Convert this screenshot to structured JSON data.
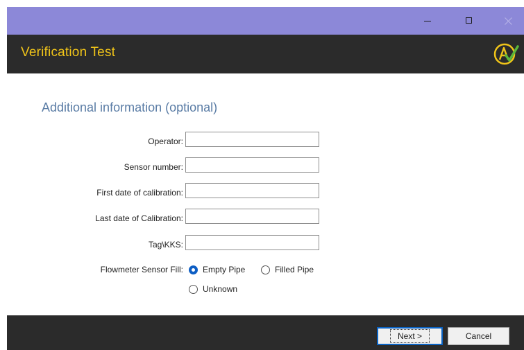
{
  "window": {
    "controls": {
      "minimize_icon": "minimize-icon",
      "maximize_icon": "maximize-icon",
      "close_icon": "close-icon"
    },
    "titlebar_color": "#8c88d8"
  },
  "header": {
    "title": "Verification Test",
    "title_color": "#f0c419",
    "background": "#2b2b2b",
    "logo_icon": "verification-logo-icon"
  },
  "main": {
    "section_title": "Additional information (optional)",
    "fields": [
      {
        "label": "Operator:",
        "value": ""
      },
      {
        "label": "Sensor number:",
        "value": ""
      },
      {
        "label": "First date of calibration:",
        "value": ""
      },
      {
        "label": "Last date of Calibration:",
        "value": ""
      },
      {
        "label": "Tag\\KKS:",
        "value": ""
      }
    ],
    "sensor_fill": {
      "label": "Flowmeter Sensor Fill:",
      "options": [
        {
          "label": "Empty Pipe",
          "selected": true
        },
        {
          "label": "Filled Pipe",
          "selected": false
        },
        {
          "label": "Unknown",
          "selected": false
        }
      ],
      "accent_color": "#0d5ec4"
    }
  },
  "footer": {
    "next_label": "Next >",
    "cancel_label": "Cancel"
  }
}
